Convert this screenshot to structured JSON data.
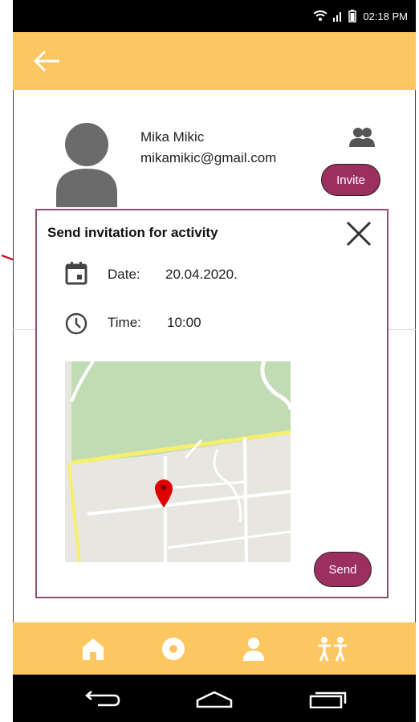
{
  "status_bar": {
    "time": "02:18 PM",
    "icons": [
      "wifi-icon",
      "signal-icon",
      "battery-icon"
    ]
  },
  "app_bar": {
    "back_icon": "arrow-left-icon"
  },
  "user": {
    "name": "Mika Mikic",
    "email": "mikamikic@gmail.com",
    "invite_label": "Invite",
    "group_icon": "people-icon"
  },
  "dialog": {
    "title": "Send invitation for activity",
    "date_label": "Date:",
    "date_value": "20.04.2020.",
    "time_label": "Time:",
    "time_value": "10:00",
    "send_label": "Send"
  },
  "bottom_nav": {
    "items": [
      "home-icon",
      "record-icon",
      "profile-icon",
      "people-icon"
    ]
  },
  "system_nav": {
    "items": [
      "back-icon",
      "home-icon",
      "recents-icon"
    ]
  },
  "colors": {
    "accent": "#fcc761",
    "button": "#9b2f5d",
    "dialog_border": "#8a4f72",
    "map_green": "#c1dbb5",
    "map_bg": "#e8e6e0",
    "road_yellow": "#f6ef6e",
    "pin": "#e00000"
  }
}
